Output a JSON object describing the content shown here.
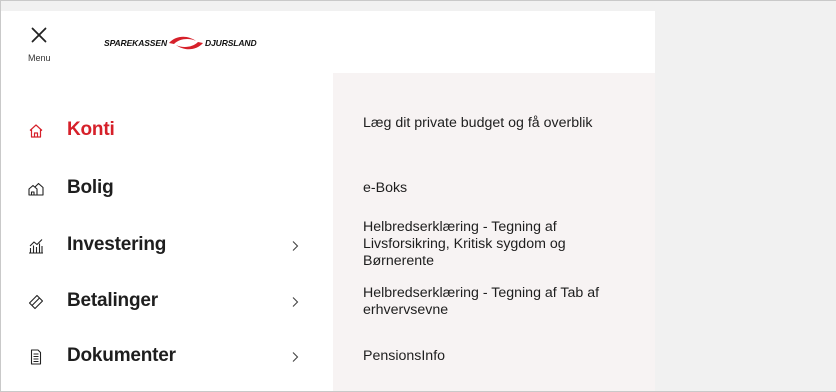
{
  "header": {
    "menu_label": "Menu",
    "logo_left": "SPAREKASSEN",
    "logo_right": "DJURSLAND",
    "accent": "#d6202a"
  },
  "nav": {
    "items": [
      {
        "label": "Konti",
        "icon": "home-icon",
        "active": true,
        "has_submenu": false
      },
      {
        "label": "Bolig",
        "icon": "houses-icon",
        "active": false,
        "has_submenu": false
      },
      {
        "label": "Investering",
        "icon": "investment-chart-icon",
        "active": false,
        "has_submenu": true
      },
      {
        "label": "Betalinger",
        "icon": "tag-icon",
        "active": false,
        "has_submenu": true
      },
      {
        "label": "Dokumenter",
        "icon": "document-icon",
        "active": false,
        "has_submenu": true
      }
    ]
  },
  "links": {
    "items": [
      {
        "label": "Læg dit private budget og få overblik"
      },
      {
        "label": "e-Boks"
      },
      {
        "label": "Helbredserklæring - Tegning af Livsforsikring, Kritisk sygdom og Børnerente"
      },
      {
        "label": "Helbredserklæring - Tegning af Tab af erhvervsevne"
      },
      {
        "label": "PensionsInfo"
      }
    ]
  }
}
